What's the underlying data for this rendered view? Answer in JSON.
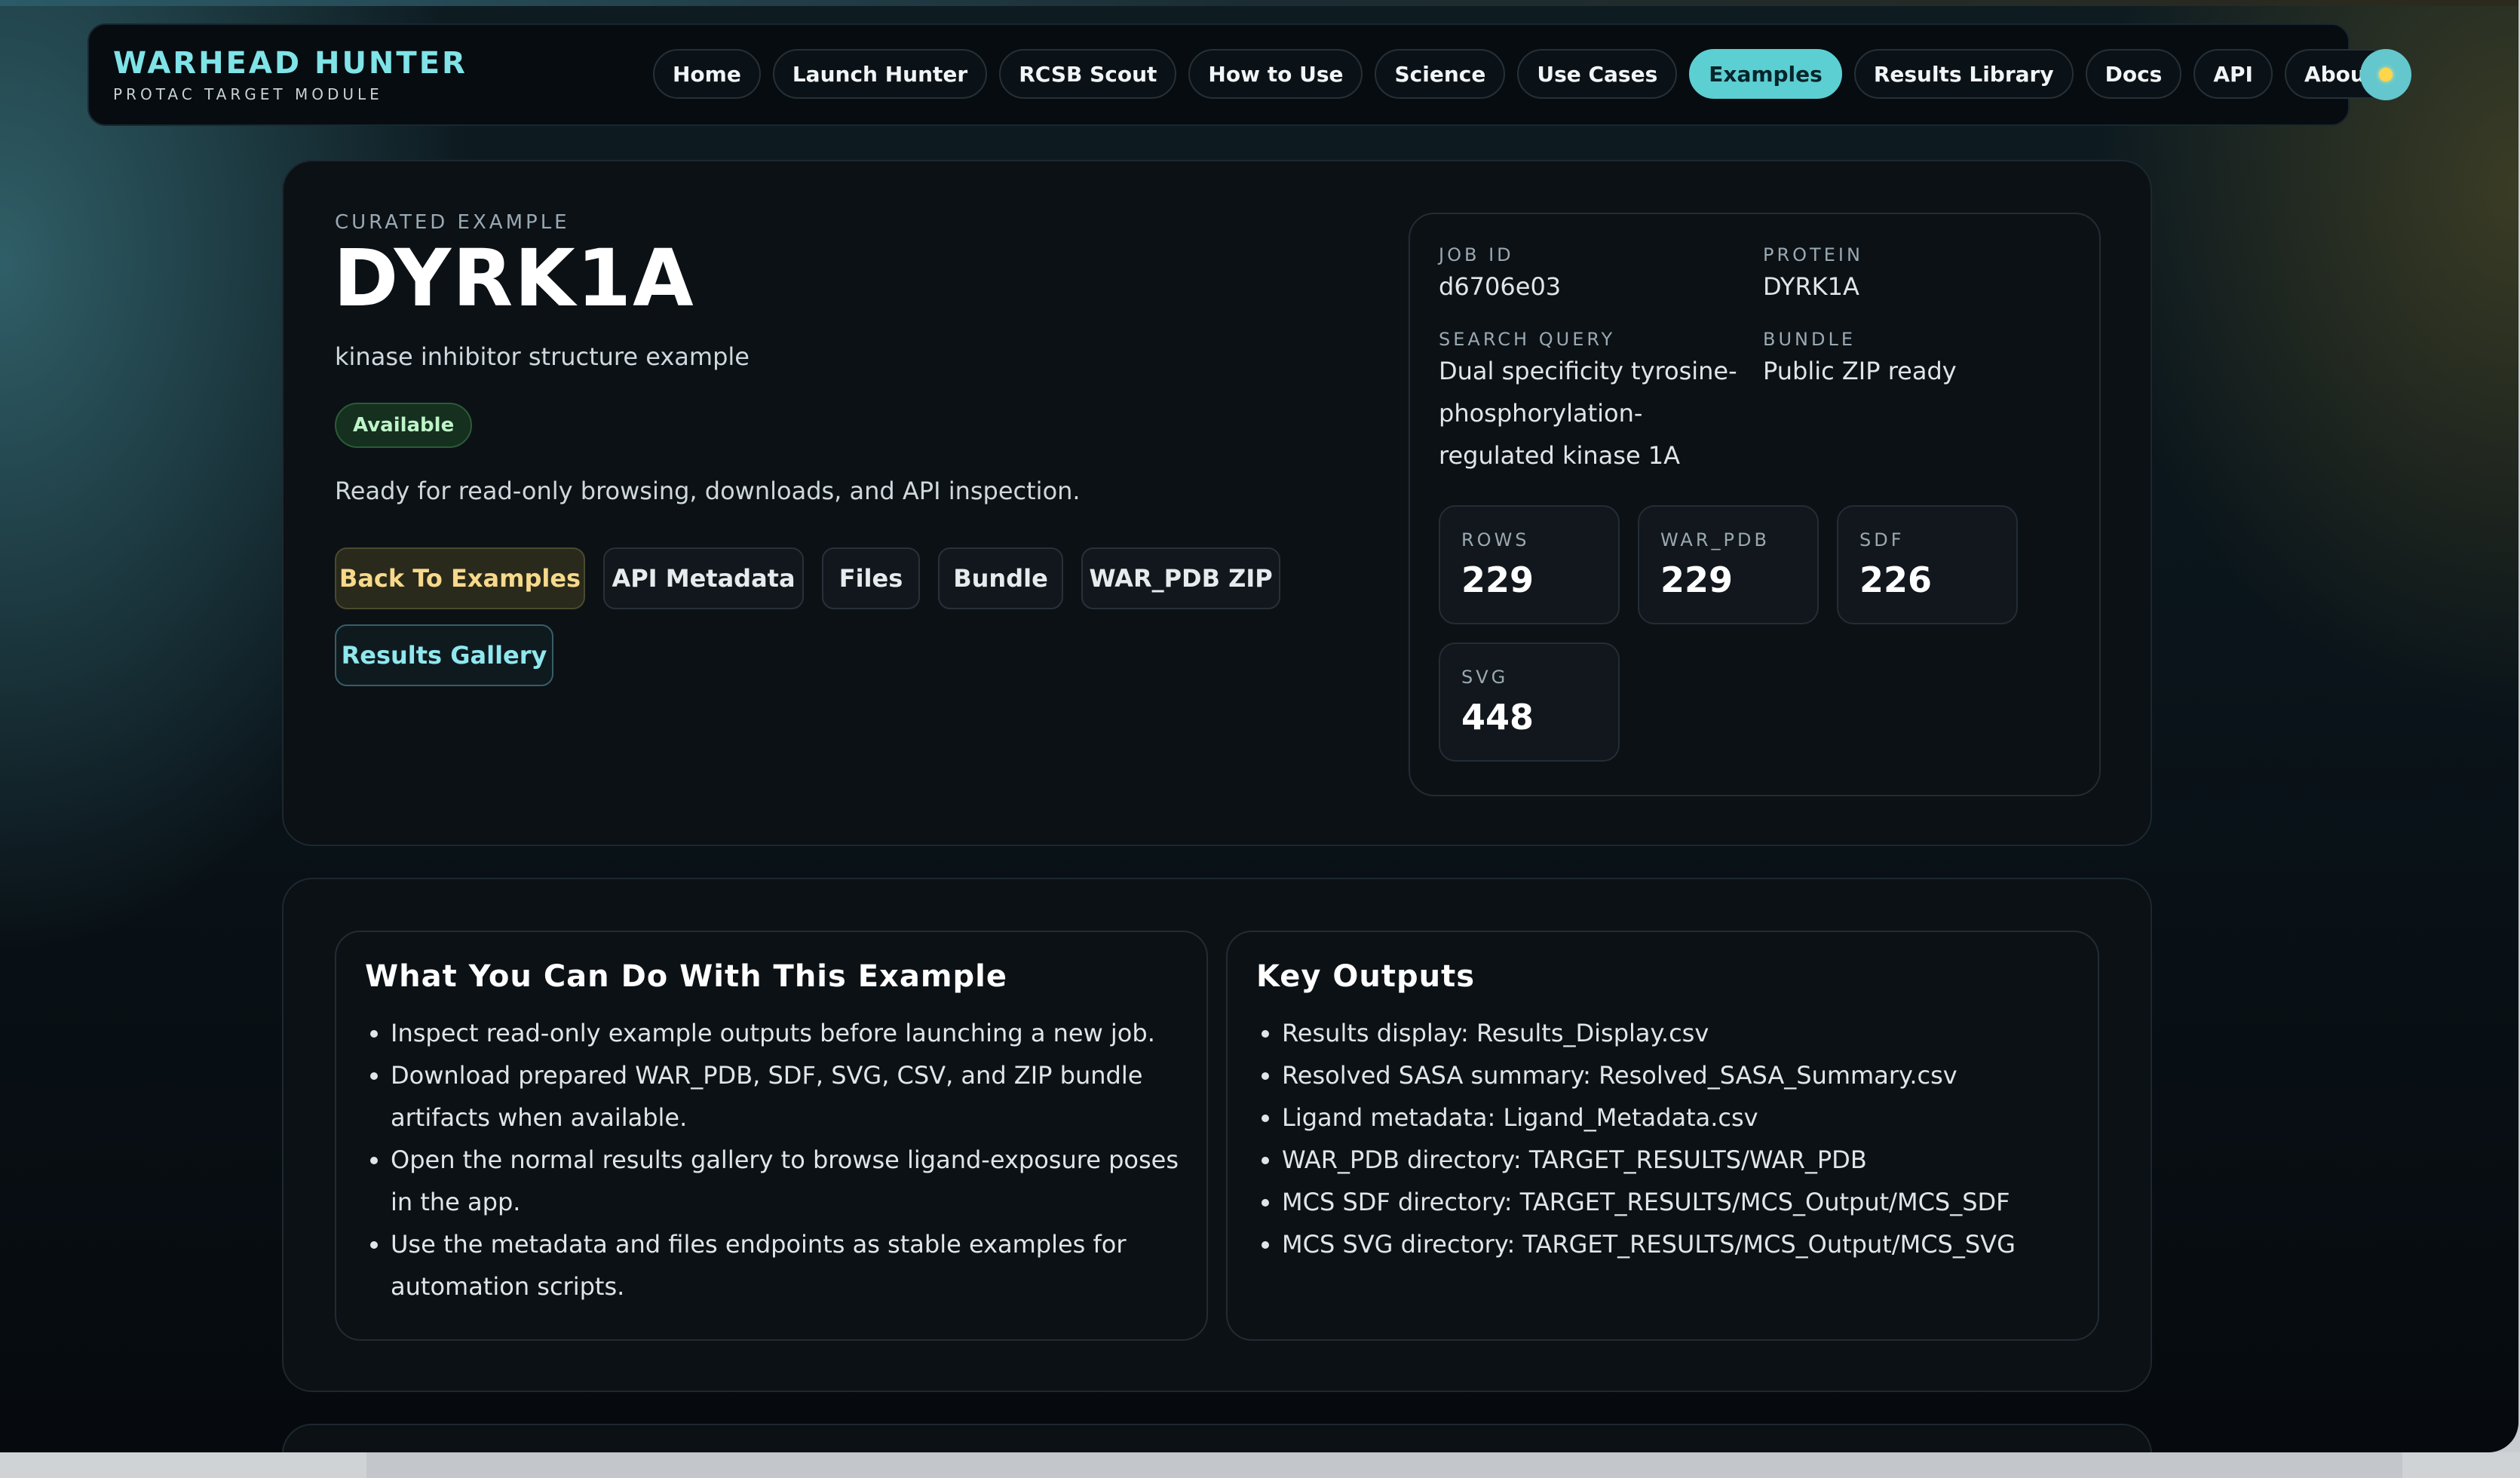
{
  "brand": {
    "title": "WARHEAD HUNTER",
    "subtitle": "PROTAC TARGET MODULE"
  },
  "nav": {
    "items": [
      "Home",
      "Launch Hunter",
      "RCSB Scout",
      "How to Use",
      "Science",
      "Use Cases",
      "Examples",
      "Results Library",
      "Docs",
      "API",
      "About"
    ],
    "active": "Examples",
    "theme_icon": "sun-icon"
  },
  "hero": {
    "eyebrow": "CURATED EXAMPLE",
    "title": "DYRK1A",
    "subtitle": "kinase inhibitor structure example",
    "badge": "Available",
    "description": "Ready for read-only browsing, downloads, and API inspection.",
    "actions": [
      "Back To Examples",
      "API Metadata",
      "Files",
      "Bundle",
      "WAR_PDB ZIP",
      "Results Gallery"
    ]
  },
  "meta": {
    "job_id_label": "JOB ID",
    "job_id": "d6706e03",
    "protein_label": "PROTEIN",
    "protein": "DYRK1A",
    "query_label": "SEARCH QUERY",
    "query_lines": [
      "Dual specificity tyrosine-",
      "phosphorylation-",
      "regulated kinase 1A"
    ],
    "bundle_label": "BUNDLE",
    "bundle": "Public ZIP ready",
    "stats": [
      {
        "label": "ROWS",
        "value": "229"
      },
      {
        "label": "WAR_PDB",
        "value": "229"
      },
      {
        "label": "SDF",
        "value": "226"
      },
      {
        "label": "SVG",
        "value": "448"
      }
    ]
  },
  "panels": {
    "left": {
      "title": "What You Can Do With This Example",
      "items": [
        "Inspect read-only example outputs before launching a new job.",
        "Download prepared WAR_PDB, SDF, SVG, CSV, and ZIP bundle artifacts when available.",
        "Open the normal results gallery to browse ligand-exposure poses in the app.",
        "Use the metadata and files endpoints as stable examples for automation scripts."
      ]
    },
    "right": {
      "title": "Key Outputs",
      "items": [
        "Results display: Results_Display.csv",
        "Resolved SASA summary: Resolved_SASA_Summary.csv",
        "Ligand metadata: Ligand_Metadata.csv",
        "WAR_PDB directory: TARGET_RESULTS/WAR_PDB",
        "MCS SDF directory: TARGET_RESULTS/MCS_Output/MCS_SDF",
        "MCS SVG directory: TARGET_RESULTS/MCS_Output/MCS_SVG"
      ]
    }
  },
  "colors": {
    "accent": "#5ccfd3",
    "brand": "#7fe3e7",
    "primary_button_text": "#f7d98a",
    "badge_bg": "#15301f"
  }
}
